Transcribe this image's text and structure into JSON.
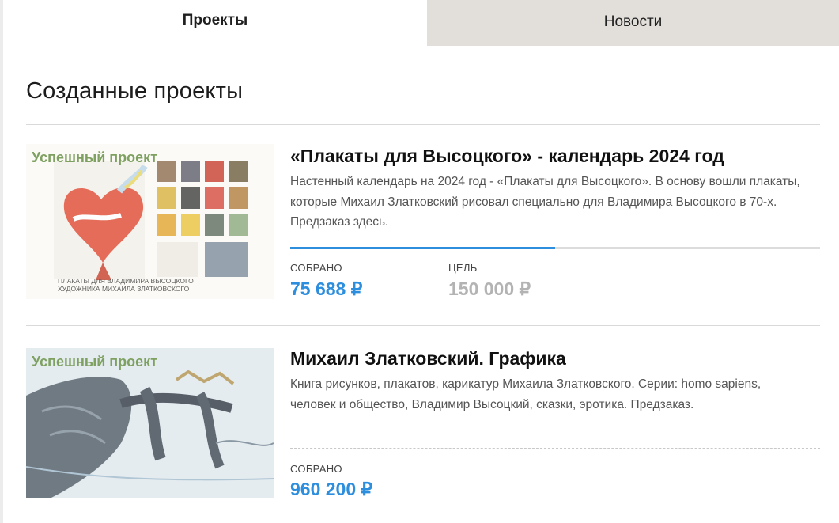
{
  "tabs": [
    {
      "label": "Проекты",
      "active": true
    },
    {
      "label": "Новости",
      "active": false
    }
  ],
  "page_title": "Созданные проекты",
  "projects": [
    {
      "badge": "Успешный проект",
      "title": "«Плакаты для Высоцкого» - календарь 2024 год",
      "description": "Настенный календарь на 2024 год - «Плакаты для Высоцкого». В основу вошли плакаты, которые Михаил Златковский рисовал специально для Владимира Высоцкого в 70-х. Предзаказ здесь.",
      "collected_label": "СОБРАНО",
      "collected_value": "75 688 ₽",
      "goal_label": "ЦЕЛЬ",
      "goal_value": "150 000 ₽",
      "progress_fraction": 0.5,
      "image_caption_lines": [
        "ПЛАКАТЫ ДЛЯ ВЛАДИМИРА ВЫСОЦКОГО",
        "ХУДОЖНИКА МИХАИЛА ЗЛАТКОВСКОГО"
      ]
    },
    {
      "badge": "Успешный проект",
      "title": "Михаил Златковский. Графика",
      "description": "Книга рисунков, плакатов, карикатур Михаила Златковского. Серии: homo sapiens, человек и общество, Владимир Высоцкий, сказки, эротика. Предзаказ.",
      "collected_label": "СОБРАНО",
      "collected_value": "960 200 ₽"
    }
  ],
  "colors": {
    "accent": "#2d8ede",
    "badge": "#7ea060",
    "goal": "#b3b3b3",
    "inactive_tab": "#e2dfda"
  }
}
